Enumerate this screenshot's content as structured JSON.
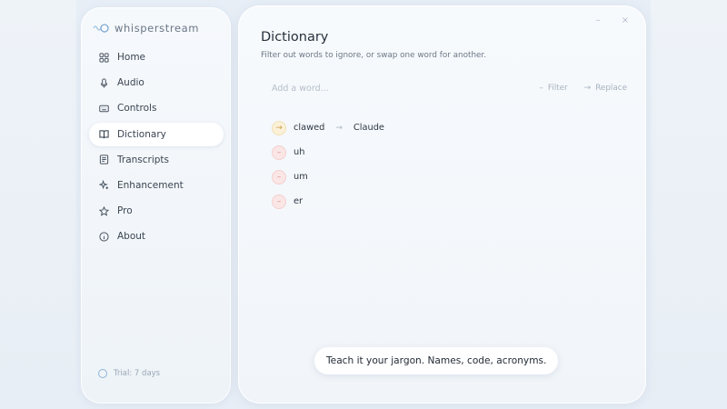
{
  "app": {
    "name": "whisperstream"
  },
  "sidebar": {
    "items": [
      {
        "label": "Home",
        "icon": "grid-icon",
        "active": false
      },
      {
        "label": "Audio",
        "icon": "microphone-icon",
        "active": false
      },
      {
        "label": "Controls",
        "icon": "keyboard-icon",
        "active": false
      },
      {
        "label": "Dictionary",
        "icon": "book-icon",
        "active": true
      },
      {
        "label": "Transcripts",
        "icon": "document-icon",
        "active": false
      },
      {
        "label": "Enhancement",
        "icon": "sparkle-icon",
        "active": false
      },
      {
        "label": "Pro",
        "icon": "star-icon",
        "active": false
      },
      {
        "label": "About",
        "icon": "info-icon",
        "active": false
      }
    ],
    "trial": "Trial: 7 days"
  },
  "window": {
    "minimize": "–",
    "close": "×"
  },
  "main": {
    "title": "Dictionary",
    "subtitle": "Filter out words to ignore, or swap one word for another.",
    "add_placeholder": "Add a word...",
    "filter_label": "Filter",
    "replace_label": "Replace",
    "words": [
      {
        "type": "replace",
        "word": "clawed",
        "replacement": "Claude"
      },
      {
        "type": "remove",
        "word": "uh"
      },
      {
        "type": "remove",
        "word": "um"
      },
      {
        "type": "remove",
        "word": "er"
      }
    ],
    "tip": "Teach it your jargon. Names, code, acronyms."
  },
  "colors": {
    "accent": "#8fb4d6",
    "replace_badge": "#fbf1d8",
    "remove_badge": "#fbe6e6"
  }
}
